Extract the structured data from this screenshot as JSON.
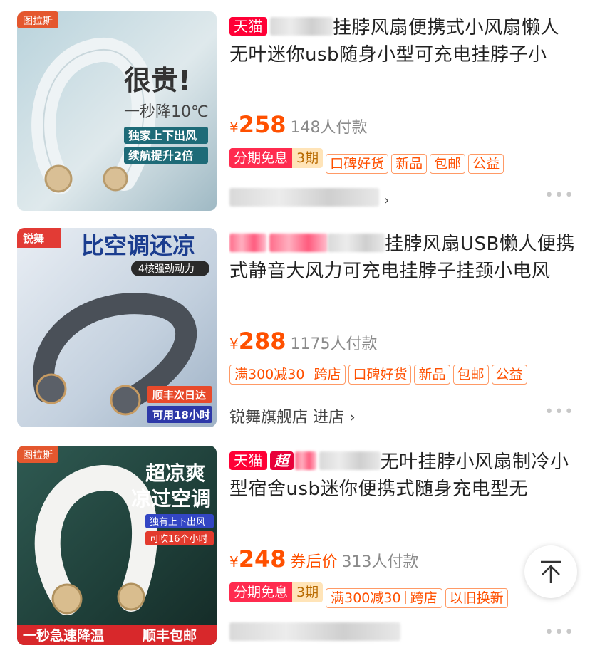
{
  "products": [
    {
      "badge": "图拉斯",
      "img_text1": "很贵!",
      "img_text2": "一秒降10℃",
      "img_text3": "独家上下出风",
      "img_text4": "续航提升2倍",
      "shop_tag": "天猫",
      "title_visible": "挂脖风扇便携式小风扇懒人无叶迷你usb随身小型可充电挂脖子小",
      "currency": "¥",
      "price": "258",
      "sold": "148人付款",
      "tags": [
        "分期免息",
        "3期",
        "口碑好货",
        "新品",
        "包邮",
        "公益"
      ],
      "more": "•••"
    },
    {
      "badge": "锐舞",
      "img_text1": "比空调还凉",
      "img_text2": "4核强劲动力",
      "img_text3": "顺丰次日达",
      "img_text4": "可用18小时",
      "title_visible": "挂脖风扇USB懒人便携式静音大风力可充电挂脖子挂颈小电风",
      "currency": "¥",
      "price": "288",
      "sold": "1175人付款",
      "tags": [
        "满300减30",
        "跨店",
        "口碑好货",
        "新品",
        "包邮",
        "公益"
      ],
      "store": "锐舞旗舰店",
      "store_link": "进店",
      "more": "•••"
    },
    {
      "badge": "图拉斯",
      "img_text1": "超凉爽",
      "img_text2": "凉过空调",
      "img_text3": "独有上下出风",
      "img_text4": "可吹16个小时",
      "img_bottom1": "一秒急速降温",
      "img_bottom2": "顺丰包邮",
      "shop_tag": "天猫",
      "shop_tag2": "超",
      "title_visible": "无叶挂脖小风扇制冷小型宿舍usb迷你便携式随身充电型无",
      "currency": "¥",
      "price": "248",
      "after_coupon": "券后价",
      "sold": "313人付款",
      "tags": [
        "分期免息",
        "3期",
        "满300减30",
        "跨店",
        "以旧换新"
      ],
      "more": "•••"
    }
  ],
  "colors": {
    "price": "#ff5000",
    "tmall": "#ff0036"
  }
}
